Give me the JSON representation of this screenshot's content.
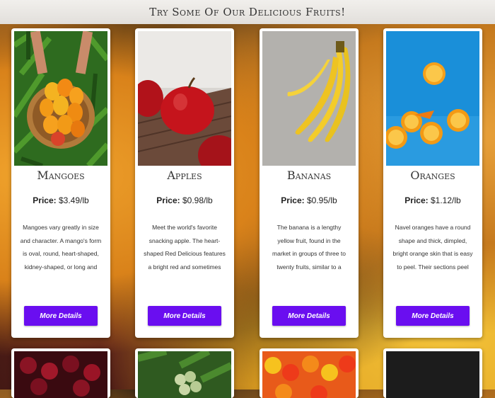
{
  "header": {
    "title": "Try Some Of Our Delicious Fruits!"
  },
  "price_label": "Price:",
  "button_label": "More Details",
  "fruits": [
    {
      "name": "Mangoes",
      "price": "$3.49/lb",
      "description": "Mangoes vary greatly in size and character. A mango's form is oval, round, heart-shaped, kidney-shaped, or long and slender. The smallest..."
    },
    {
      "name": "Apples",
      "price": "$0.98/lb",
      "description": "Meet the world's favorite snacking apple. The heart-shaped Red Delicious features a bright red and sometimes striped skin. Renowne..."
    },
    {
      "name": "Bananas",
      "price": "$0.95/lb",
      "description": "The banana is a lengthy yellow fruit, found in the market in groups of three to twenty fruits, similar to a triangular cucumber, oblong and..."
    },
    {
      "name": "Oranges",
      "price": "$1.12/lb",
      "description": "Navel oranges have a round shape and thick, dimpled, bright orange skin that is easy to peel. Their sections peel apart easily, and the..."
    }
  ]
}
